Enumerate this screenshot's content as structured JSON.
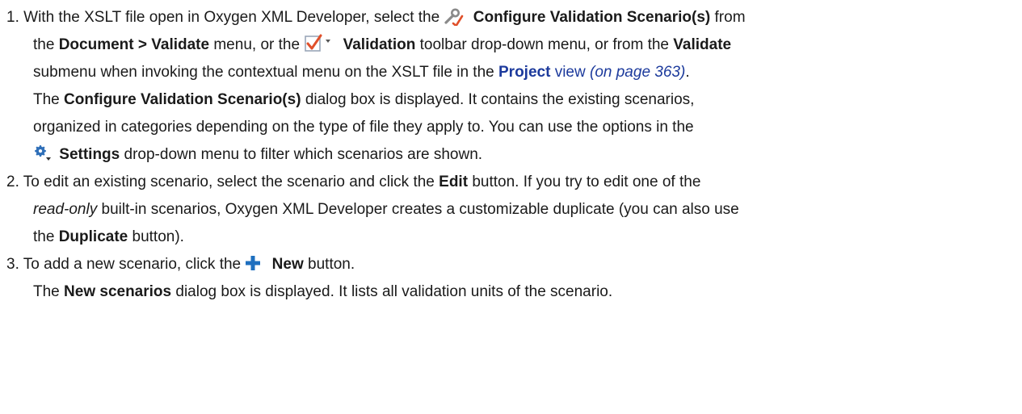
{
  "steps": [
    {
      "number": "1.",
      "lines": {
        "l1": {
          "pre": "With the XSLT file open in Oxygen XML Developer, select the",
          "action": "Configure Validation Scenario(s)",
          "post": "from"
        },
        "l2": {
          "pre": "the",
          "menu_path": "Document > Validate",
          "mid": "menu, or the",
          "toolbar": "Validation",
          "mid2": "toolbar drop-down menu, or from the",
          "submenu": "Validate"
        },
        "l3": {
          "pre": "submenu when invoking the contextual menu on the XSLT file in the",
          "view_name": "Project",
          "view_word": "view",
          "page_ref": "(on page 363)",
          "post": "."
        },
        "l4": {
          "pre": "The",
          "dialog": "Configure Validation Scenario(s)",
          "post": "dialog box is displayed. It contains the existing scenarios,"
        },
        "l5": {
          "text": "organized in categories depending on the type of file they apply to. You can use the options in the"
        },
        "l6": {
          "settings": "Settings",
          "post": "drop-down menu to filter which scenarios are shown."
        }
      }
    },
    {
      "number": "2.",
      "lines": {
        "l1": {
          "pre": "To edit an existing scenario, select the scenario and click the",
          "button": "Edit",
          "post": "button. If you try to edit one of the"
        },
        "l2": {
          "em": "read-only",
          "post": "built-in scenarios, Oxygen XML Developer creates a customizable duplicate (you can also use"
        },
        "l3": {
          "pre": "the",
          "button": "Duplicate",
          "post": "button)."
        }
      }
    },
    {
      "number": "3.",
      "lines": {
        "l1": {
          "pre": "To add a new scenario, click the",
          "button": "New",
          "post": "button."
        },
        "l2": {
          "pre": "The",
          "dialog": "New scenarios",
          "post": "dialog box is displayed. It lists all validation units of the scenario."
        }
      }
    }
  ],
  "icons": {
    "configure": "wrench-checkmark-icon",
    "validation": "validation-checkbox-icon",
    "dropdown": "dropdown-arrow-icon",
    "settings": "gear-dropdown-icon",
    "new": "plus-icon"
  },
  "colors": {
    "text": "#1a1a1a",
    "link": "#1c3a9c",
    "check_red": "#e0502a",
    "plus_blue": "#1e6fbf",
    "gear_blue": "#2f6fb8"
  }
}
